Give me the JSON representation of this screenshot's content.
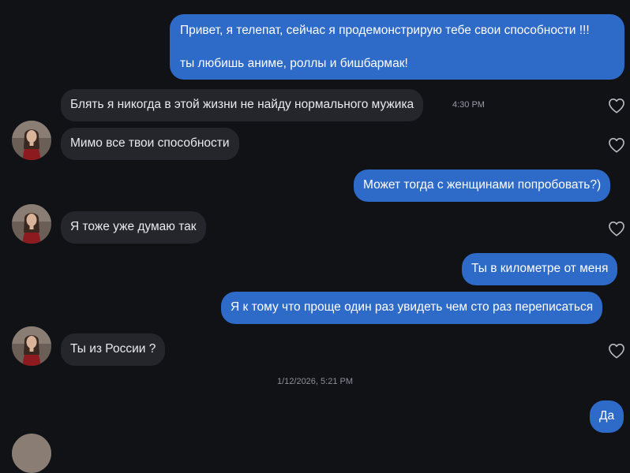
{
  "conversation": {
    "messages": [
      {
        "side": "out",
        "lines": [
          "Привет, я телепат, сейчас я продемонстрирую тебе свои способности !!!",
          "ты любишь аниме, роллы и бишбармак!"
        ]
      },
      {
        "side": "in",
        "text": "Блять я никогда в этой жизни не найду нормального мужика",
        "time": "4:30 PM"
      },
      {
        "side": "in",
        "text": "Мимо все твои способности"
      },
      {
        "side": "out",
        "text": "Может тогда с женщинами попробовать?)"
      },
      {
        "side": "in",
        "text": "Я тоже уже думаю так"
      },
      {
        "side": "out",
        "text": "Ты в километре от меня"
      },
      {
        "side": "out",
        "text": "Я к тому что проще один раз увидеть чем сто раз переписаться"
      },
      {
        "side": "in",
        "text": "Ты из России ?"
      },
      {
        "side": "out",
        "text": "Да"
      }
    ],
    "date_separator": "1/12/2026, 5:21 PM"
  },
  "colors": {
    "background": "#111216",
    "outgoing_bubble": "#2e6ac7",
    "incoming_bubble": "#25262c"
  },
  "icons": {
    "like": "heart-outline-icon",
    "avatar": "contact-avatar"
  }
}
